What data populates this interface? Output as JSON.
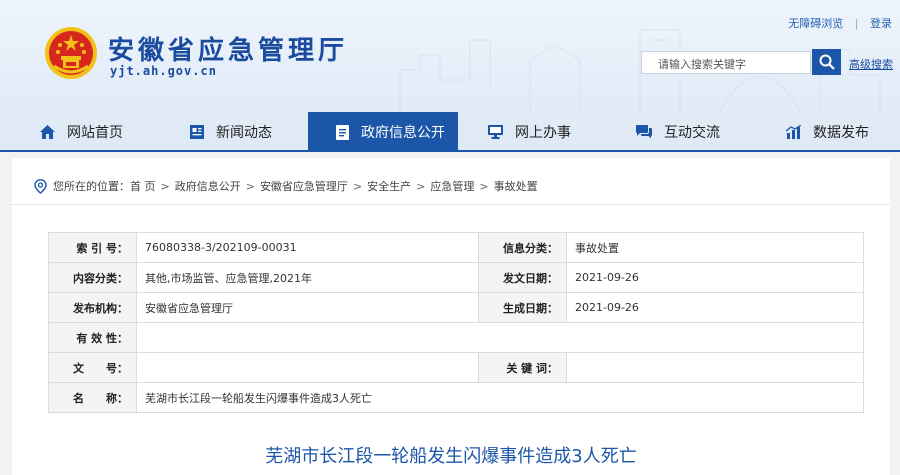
{
  "header": {
    "site_name": "安徽省应急管理厅",
    "site_domain": "yjt.ah.gov.cn",
    "top_links": {
      "accessible": "无障碍浏览",
      "login": "登录"
    },
    "search": {
      "placeholder": "请输入搜索关键字",
      "advanced": "高级搜索"
    }
  },
  "nav": {
    "items": [
      {
        "label": "网站首页",
        "icon": "home-icon"
      },
      {
        "label": "新闻动态",
        "icon": "news-icon"
      },
      {
        "label": "政府信息公开",
        "icon": "document-icon",
        "active": true
      },
      {
        "label": "网上办事",
        "icon": "monitor-icon"
      },
      {
        "label": "互动交流",
        "icon": "chat-icon"
      },
      {
        "label": "数据发布",
        "icon": "chart-icon"
      }
    ]
  },
  "breadcrumb": {
    "prefix": "您所在的位置：",
    "items": [
      "首 页",
      "政府信息公开",
      "安徽省应急管理厅",
      "安全生产",
      "应急管理",
      "事故处置"
    ]
  },
  "meta": {
    "index_label": "索 引 号：",
    "index_value": "76080338-3/202109-00031",
    "category_label": "信息分类：",
    "category_value": "事故处置",
    "content_type_label": "内容分类：",
    "content_type_value": "其他,市场监管、应急管理,2021年",
    "publish_date_label": "发文日期：",
    "publish_date_value": "2021-09-26",
    "org_label": "发布机构：",
    "org_value": "安徽省应急管理厅",
    "gen_date_label": "生成日期：",
    "gen_date_value": "2021-09-26",
    "validity_label": "有 效 性：",
    "validity_value": "",
    "doc_no_label": "文　　号：",
    "doc_no_value": "",
    "keywords_label": "关 键 词：",
    "keywords_value": "",
    "name_label": "名　　称：",
    "name_value": "芜湖市长江段一轮船发生闪爆事件造成3人死亡"
  },
  "article": {
    "title": "芜湖市长江段一轮船发生闪爆事件造成3人死亡"
  },
  "colors": {
    "primary": "#1c56a8",
    "title_blue": "#1a4b9e",
    "emblem_red": "#d7261e",
    "emblem_gold": "#f2c21a"
  }
}
